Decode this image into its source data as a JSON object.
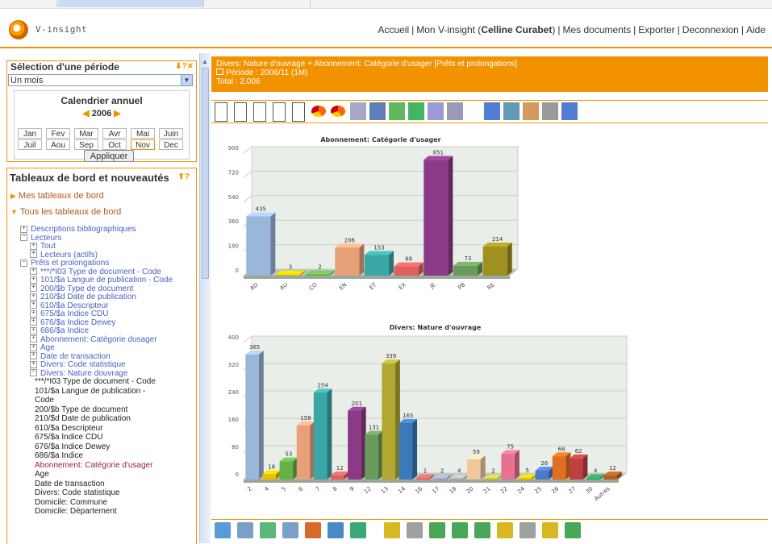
{
  "header": {
    "logo_text": "V-insight",
    "nav_home": "Accueil",
    "nav_my_prefix": "Mon V-insight (",
    "nav_user": "Celline Curabet",
    "nav_my_suffix": ")",
    "nav_documents": "Mes documents",
    "nav_export": "Exporter",
    "nav_logout": "Deconnexion",
    "nav_help": "Aide",
    "separator": "|"
  },
  "period_panel": {
    "title": "Sélection d'une période",
    "icons": "⬇?✕",
    "select_value": "Un mois",
    "calendar_title": "Calendrier annuel",
    "year": "2006",
    "months": [
      "Jan",
      "Fev",
      "Mar",
      "Avr",
      "Mai",
      "Juin",
      "Juil",
      "Aou",
      "Sep",
      "Oct",
      "Nov",
      "Dec"
    ],
    "selected_month": "Nov",
    "apply_label": "Appliquer"
  },
  "tree_panel": {
    "title": "Tableaux de bord et nouveautés",
    "icons": "⬆?",
    "section_mine": "Mes tableaux de bord",
    "section_all": "Tous les tableaux de bord",
    "items": [
      {
        "text": "Descriptions bibliographiques",
        "indent": 1,
        "style": "link",
        "box": "+"
      },
      {
        "text": "Lecteurs",
        "indent": 1,
        "style": "link",
        "box": "-"
      },
      {
        "text": "Tout",
        "indent": 2,
        "style": "link",
        "box": "+"
      },
      {
        "text": "Lecteurs (actifs)",
        "indent": 2,
        "style": "link",
        "box": "+"
      },
      {
        "text": "Prêts et prolongations",
        "indent": 1,
        "style": "link",
        "box": "-"
      },
      {
        "text": "***/*I03 Type de document - Code",
        "indent": 2,
        "style": "link",
        "box": "+"
      },
      {
        "text": "101/$a Langue de publication - Code",
        "indent": 2,
        "style": "link",
        "box": "+"
      },
      {
        "text": "200/$b Type de document",
        "indent": 2,
        "style": "link",
        "box": "+"
      },
      {
        "text": "210/$d Date de publication",
        "indent": 2,
        "style": "link",
        "box": "+"
      },
      {
        "text": "610/$a Descripteur",
        "indent": 2,
        "style": "link",
        "box": "+"
      },
      {
        "text": "675/$a Indice CDU",
        "indent": 2,
        "style": "link",
        "box": "+"
      },
      {
        "text": "676/$a Indice Dewey",
        "indent": 2,
        "style": "link",
        "box": "+"
      },
      {
        "text": "686/$a Indice",
        "indent": 2,
        "style": "link",
        "box": "+"
      },
      {
        "text": "Abonnement: Catégorie dusager",
        "indent": 2,
        "style": "link",
        "box": "+"
      },
      {
        "text": "Age",
        "indent": 2,
        "style": "link",
        "box": "+"
      },
      {
        "text": "Date de transaction",
        "indent": 2,
        "style": "link",
        "box": "+"
      },
      {
        "text": "Divers: Code statistique",
        "indent": 2,
        "style": "link",
        "box": "+"
      },
      {
        "text": "Divers: Nature douvrage",
        "indent": 2,
        "style": "link",
        "box": "-"
      },
      {
        "text": "***/*I03 Type de document - Code",
        "indent": 3,
        "style": "plain",
        "box": ""
      },
      {
        "text": "101/$a Langue de publication -",
        "indent": 3,
        "style": "plain",
        "box": ""
      },
      {
        "text": "Code",
        "indent": 3,
        "style": "plain",
        "box": ""
      },
      {
        "text": "200/$b Type de document",
        "indent": 3,
        "style": "plain",
        "box": ""
      },
      {
        "text": "210/$d Date de publication",
        "indent": 3,
        "style": "plain",
        "box": ""
      },
      {
        "text": "610/$a Descripteur",
        "indent": 3,
        "style": "plain",
        "box": ""
      },
      {
        "text": "675/$a Indice CDU",
        "indent": 3,
        "style": "plain",
        "box": ""
      },
      {
        "text": "676/$a Indice Dewey",
        "indent": 3,
        "style": "plain",
        "box": ""
      },
      {
        "text": "686/$a Indice",
        "indent": 3,
        "style": "plain",
        "box": ""
      },
      {
        "text": "Abonnement: Catégorie d'usager",
        "indent": 3,
        "style": "red",
        "box": ""
      },
      {
        "text": "Age",
        "indent": 3,
        "style": "plain",
        "box": ""
      },
      {
        "text": "Date de transaction",
        "indent": 3,
        "style": "plain",
        "box": ""
      },
      {
        "text": "Divers: Code statistique",
        "indent": 3,
        "style": "plain",
        "box": ""
      },
      {
        "text": "Domicile: Commune",
        "indent": 3,
        "style": "plain",
        "box": ""
      },
      {
        "text": "Domicile: Département",
        "indent": 3,
        "style": "plain",
        "box": ""
      }
    ]
  },
  "infobar": {
    "line1": "Divers: Nature d'ouvrage + Abonnement: Catégorie d'usager [Prêts et prolongations]",
    "line2": "Période : 2006/11 (1M)",
    "line3": "Total : 2.006"
  },
  "toolbar_icons": [
    "new-doc-icon",
    "edit-doc-icon",
    "copy-doc-icon",
    "delete-doc-icon",
    "page-icon",
    "pie-chart-icon",
    "donut-chart-icon",
    "bar-chart-icon",
    "color-bar-chart-icon",
    "table-icon",
    "refresh-icon",
    "grid-icon",
    "print-icon",
    "scissors-icon",
    "glasses-icon",
    "frame-icon",
    "settings-icon",
    "attach-icon"
  ],
  "bottom_icons": [
    "nav-first-icon",
    "nav-prev-icon",
    "nav-up-icon",
    "nav-down-icon",
    "chart-export-icon",
    "chart-export2-icon",
    "chart-export3-icon",
    "arrow-left-icon",
    "arrow-left-gray-icon",
    "arrow-down-left-icon",
    "arrow-swap-icon",
    "arrow-both-icon",
    "arrow-return-icon",
    "arrow-return-gray-icon",
    "arrow-right-icon",
    "arrow-right2-icon"
  ],
  "colors": {
    "accent": "#f39200",
    "link": "#4a5fc2"
  },
  "chart_data": [
    {
      "type": "bar",
      "title": "Abonnement: Catégorie d'usager",
      "categories": [
        "AD",
        "AU",
        "CO",
        "EN",
        "ET",
        "EX",
        "JE",
        "PB",
        "RE"
      ],
      "values": [
        435,
        3,
        2,
        206,
        153,
        69,
        851,
        73,
        214
      ],
      "bar_colors": [
        "#9ab6d8",
        "#e6c200",
        "#66b04a",
        "#e8a07a",
        "#3aa6a6",
        "#e06060",
        "#8a3a86",
        "#6a9a5a",
        "#a09020"
      ],
      "ylim": [
        0,
        900
      ],
      "yticks": [
        0,
        180,
        360,
        540,
        720,
        900
      ],
      "grid": true
    },
    {
      "type": "bar",
      "title": "Divers: Nature d'ouvrage",
      "categories": [
        "2",
        "4",
        "5",
        "6",
        "7",
        "8",
        "9",
        "12",
        "13",
        "14",
        "16",
        "17",
        "18",
        "20",
        "21",
        "22",
        "24",
        "25",
        "26",
        "27",
        "30",
        "Autres"
      ],
      "values": [
        365,
        16,
        53,
        158,
        254,
        12,
        201,
        131,
        339,
        165,
        1,
        2,
        4,
        59,
        2,
        75,
        5,
        26,
        68,
        62,
        4,
        12
      ],
      "bar_colors": [
        "#9ab6d8",
        "#e6c200",
        "#66b04a",
        "#e8a07a",
        "#3aa6a6",
        "#e06060",
        "#8a3a86",
        "#6a9a5a",
        "#b0a830",
        "#3a7ab8",
        "#e06060",
        "#a0a0c0",
        "#b0b0b0",
        "#f0c8a0",
        "#c0c040",
        "#e87090",
        "#e6c200",
        "#4a7ac8",
        "#e07020",
        "#c04040",
        "#30a060",
        "#b06020"
      ],
      "ylim": [
        0,
        400
      ],
      "yticks": [
        0,
        80,
        160,
        240,
        320,
        400
      ],
      "grid": true
    }
  ]
}
